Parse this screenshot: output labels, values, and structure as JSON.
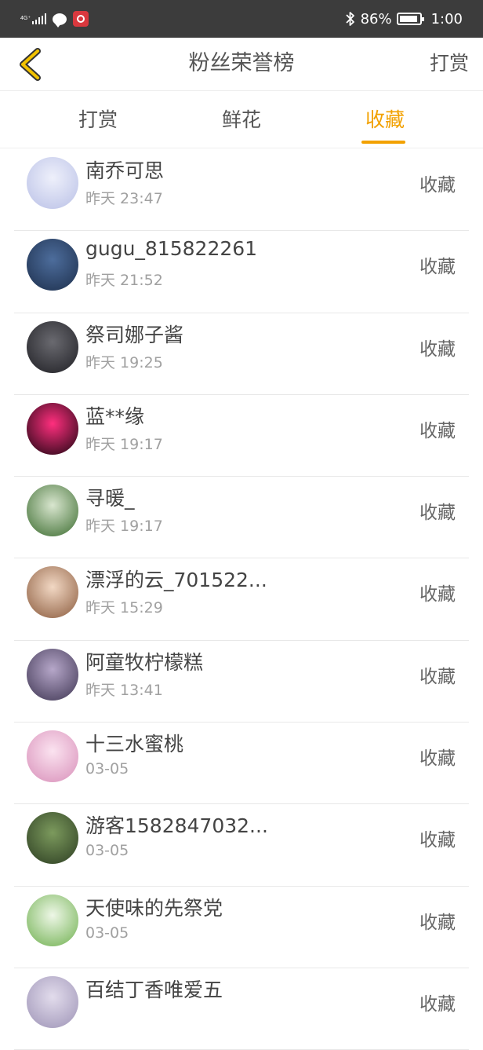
{
  "status_bar": {
    "network": "4G⁺",
    "battery": "86%",
    "time": "1:00",
    "bluetooth_icon": "bluetooth-icon"
  },
  "nav": {
    "title": "粉丝荣誉榜",
    "right_label": "打赏",
    "back_icon": "chevron-left-icon"
  },
  "tabs": [
    {
      "label": "打赏",
      "active": false
    },
    {
      "label": "鲜花",
      "active": false
    },
    {
      "label": "收藏",
      "active": true
    }
  ],
  "accent_color": "#f2a100",
  "fans": [
    {
      "name": "南乔可思",
      "time": "昨天 23:47",
      "action": "收藏",
      "avatar_colors": [
        "#eef0fb",
        "#b9c0e6"
      ]
    },
    {
      "name": "gugu_815822261",
      "time": "昨天 21:52",
      "action": "收藏",
      "avatar_colors": [
        "#4d6d9c",
        "#1d2f4c"
      ]
    },
    {
      "name": "祭司娜子酱",
      "time": "昨天 19:25",
      "action": "收藏",
      "avatar_colors": [
        "#6a6a70",
        "#1f1f24"
      ]
    },
    {
      "name": "蓝**缘",
      "time": "昨天 19:17",
      "action": "收藏",
      "avatar_colors": [
        "#ff2f7e",
        "#1a0510"
      ]
    },
    {
      "name": "寻暖_",
      "time": "昨天 19:17",
      "action": "收藏",
      "avatar_colors": [
        "#d9e6cf",
        "#3a6b2e"
      ]
    },
    {
      "name": "漂浮的云_701522...",
      "time": "昨天 15:29",
      "action": "收藏",
      "avatar_colors": [
        "#f2d8c4",
        "#8a5a3c"
      ]
    },
    {
      "name": "阿童牧柠檬糕",
      "time": "昨天 13:41",
      "action": "收藏",
      "avatar_colors": [
        "#b6a7c9",
        "#3e3552"
      ]
    },
    {
      "name": "十三水蜜桃",
      "time": "03-05",
      "action": "收藏",
      "avatar_colors": [
        "#fbe3f0",
        "#d88fb9"
      ]
    },
    {
      "name": "游客1582847032...",
      "time": "03-05",
      "action": "收藏",
      "avatar_colors": [
        "#7c9a5d",
        "#2c3d22"
      ]
    },
    {
      "name": "天使味的先祭党",
      "time": "03-05",
      "action": "收藏",
      "avatar_colors": [
        "#eef7e7",
        "#6fb04f"
      ]
    },
    {
      "name": "百结丁香唯爱五",
      "time": "",
      "action": "收藏",
      "avatar_colors": [
        "#e2dcec",
        "#9d93b6"
      ]
    }
  ]
}
